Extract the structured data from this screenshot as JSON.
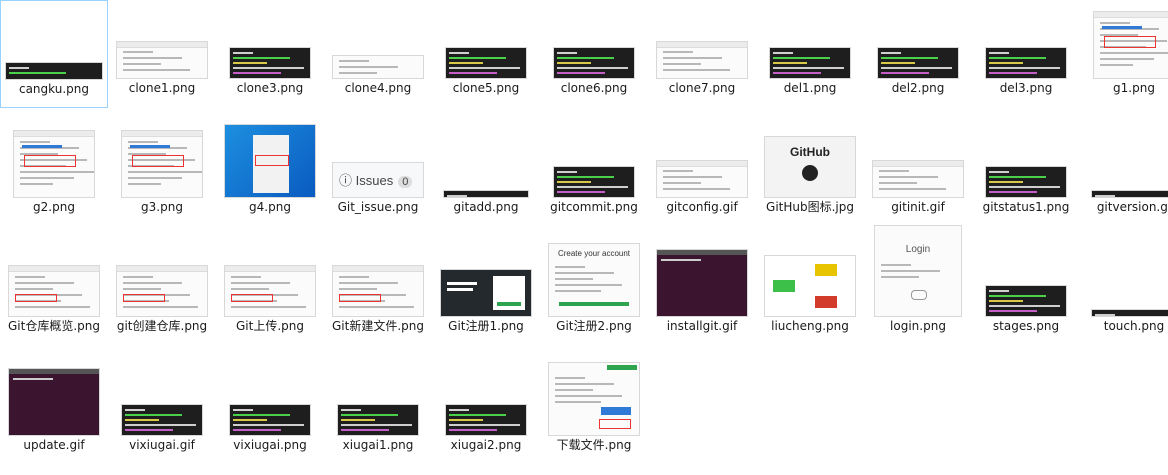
{
  "files": [
    {
      "name": "cangku.png",
      "selected": true,
      "kind": "term-wide"
    },
    {
      "name": "clone1.png",
      "kind": "win"
    },
    {
      "name": "clone3.png",
      "kind": "term"
    },
    {
      "name": "clone4.png",
      "kind": "explorer"
    },
    {
      "name": "clone5.png",
      "kind": "term"
    },
    {
      "name": "clone6.png",
      "kind": "term"
    },
    {
      "name": "clone7.png",
      "kind": "win"
    },
    {
      "name": "del1.png",
      "kind": "term"
    },
    {
      "name": "del2.png",
      "kind": "term"
    },
    {
      "name": "del3.png",
      "kind": "term"
    },
    {
      "name": "g1.png",
      "kind": "dialog"
    },
    {
      "name": "g2.png",
      "kind": "dialog"
    },
    {
      "name": "g3.png",
      "kind": "dialog"
    },
    {
      "name": "g4.png",
      "kind": "desktop"
    },
    {
      "name": "Git_issue.png",
      "kind": "issues"
    },
    {
      "name": "gitadd.png",
      "kind": "term-thin"
    },
    {
      "name": "gitcommit.png",
      "kind": "term"
    },
    {
      "name": "gitconfig.gif",
      "kind": "win"
    },
    {
      "name": "GitHub图标.jpg",
      "kind": "github"
    },
    {
      "name": "gitinit.gif",
      "kind": "win"
    },
    {
      "name": "gitstatus1.png",
      "kind": "term"
    },
    {
      "name": "gitversion.gi",
      "kind": "term-thin"
    },
    {
      "name": "Git仓库概览.png",
      "kind": "web"
    },
    {
      "name": "git创建仓库.png",
      "kind": "web"
    },
    {
      "name": "Git上传.png",
      "kind": "web"
    },
    {
      "name": "Git新建文件.png",
      "kind": "web"
    },
    {
      "name": "Git注册1.png",
      "kind": "signup-dark"
    },
    {
      "name": "Git注册2.png",
      "kind": "create-account"
    },
    {
      "name": "installgit.gif",
      "kind": "purple"
    },
    {
      "name": "liucheng.png",
      "kind": "flow"
    },
    {
      "name": "login.png",
      "kind": "login"
    },
    {
      "name": "stages.png",
      "kind": "term"
    },
    {
      "name": "touch.png",
      "kind": "term-thin"
    },
    {
      "name": "update.gif",
      "kind": "purple"
    },
    {
      "name": "vixiugai.gif",
      "kind": "term"
    },
    {
      "name": "vixiugai.png",
      "kind": "term"
    },
    {
      "name": "xiugai1.png",
      "kind": "term"
    },
    {
      "name": "xiugai2.png",
      "kind": "term"
    },
    {
      "name": "下载文件.png",
      "kind": "download"
    }
  ],
  "thumb_text": {
    "issues_label": "Issues",
    "issues_count": "0",
    "github_word": "GitHub",
    "create_account": "Create your account",
    "login_word": "Login"
  }
}
